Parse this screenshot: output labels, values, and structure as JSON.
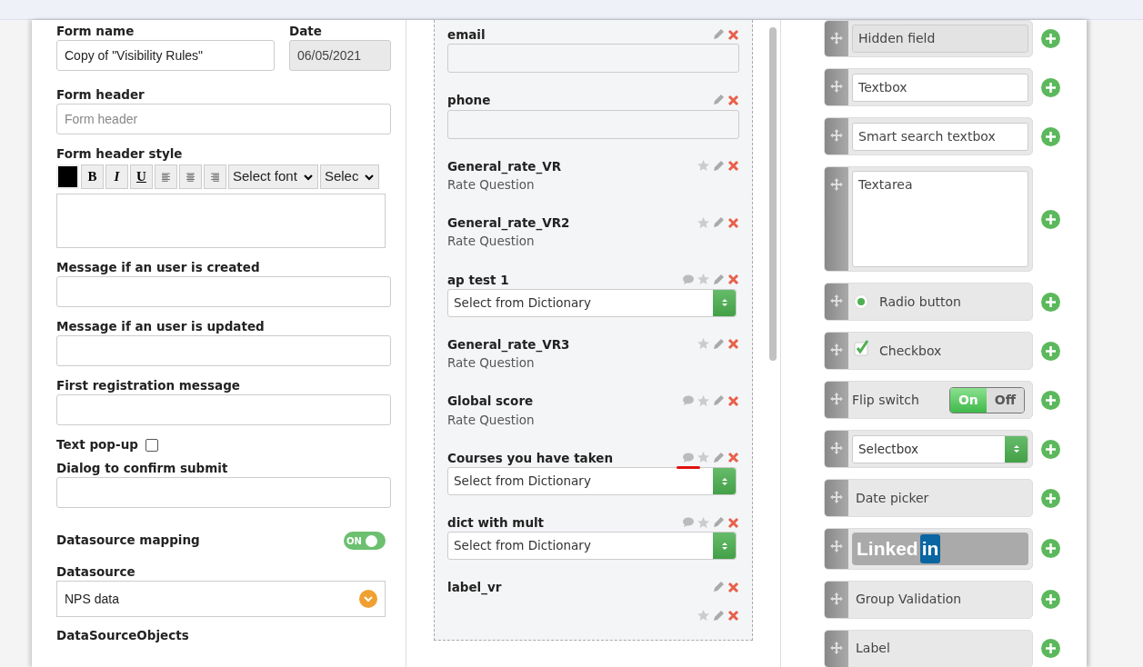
{
  "form": {
    "form_name": {
      "label": "Form name",
      "value": "Copy of \"Visibility Rules\""
    },
    "date": {
      "label": "Date",
      "value": "06/05/2021"
    },
    "form_header": {
      "label": "Form header",
      "placeholder": "Form header"
    },
    "form_header_style": {
      "label": "Form header style",
      "bold": "B",
      "italic": "I",
      "underline": "U",
      "font_select": "Select font",
      "size_select": "Selec"
    },
    "messages": [
      {
        "label": "Message if an user is created"
      },
      {
        "label": "Message if an user is updated"
      },
      {
        "label": "First registration message"
      }
    ],
    "text_popup": {
      "label": "Text pop-up",
      "checked": false
    },
    "dialog": {
      "label": "Dialog to confirm submit"
    },
    "datasource_mapping": {
      "label": "Datasource mapping",
      "on": true,
      "toggle_text": "ON"
    },
    "datasource": {
      "label": "Datasource",
      "value": "NPS data"
    },
    "datasource_objects": {
      "label": "DataSourceObjects"
    }
  },
  "fields": [
    {
      "name": "email",
      "kind": "input",
      "comment": false,
      "star": false
    },
    {
      "name": "phone",
      "kind": "input",
      "comment": false,
      "star": false
    },
    {
      "name": "General_rate_VR",
      "kind": "rate",
      "sub": "Rate Question",
      "comment": false,
      "star": true
    },
    {
      "name": "General_rate_VR2",
      "kind": "rate",
      "sub": "Rate Question",
      "comment": false,
      "star": true
    },
    {
      "name": "ap test 1",
      "kind": "dict",
      "sub": "Select from Dictionary",
      "comment": true,
      "star": true
    },
    {
      "name": "General_rate_VR3",
      "kind": "rate",
      "sub": "Rate Question",
      "comment": false,
      "star": true
    },
    {
      "name": "Global score",
      "kind": "rate",
      "sub": "Rate Question",
      "comment": true,
      "star": true
    },
    {
      "name": "Courses you have taken",
      "kind": "dict",
      "sub": "Select from Dictionary",
      "comment": true,
      "star": true,
      "flagged": true
    },
    {
      "name": "dict with mult",
      "kind": "dict",
      "sub": "Select from Dictionary",
      "comment": true,
      "star": true
    },
    {
      "name": "label_vr",
      "kind": "label",
      "comment": false,
      "star": false
    },
    {
      "kind": "cut",
      "comment": false,
      "star": true
    }
  ],
  "palette": [
    {
      "kind": "hidden",
      "label": "Hidden field"
    },
    {
      "kind": "textbox",
      "label": "Textbox"
    },
    {
      "kind": "textbox",
      "label": "Smart search textbox"
    },
    {
      "kind": "textarea",
      "label": "Textarea"
    },
    {
      "kind": "radio",
      "label": "Radio button",
      "selected": true
    },
    {
      "kind": "checkbox",
      "label": "Checkbox",
      "checked": true
    },
    {
      "kind": "flip",
      "label": "Flip switch",
      "on_text": "On",
      "off_text": "Off",
      "on": true
    },
    {
      "kind": "select",
      "label": "Selectbox"
    },
    {
      "kind": "plain",
      "label": "Date picker"
    },
    {
      "kind": "linkedin",
      "label": "Linked",
      "badge": "in"
    },
    {
      "kind": "plain",
      "label": "Group Validation"
    },
    {
      "kind": "plain",
      "label": "Label"
    }
  ]
}
